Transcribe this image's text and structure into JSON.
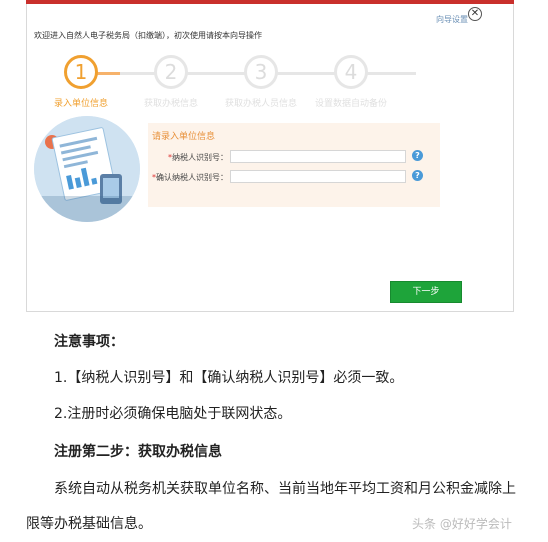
{
  "dialog": {
    "welcome_text": "欢迎进入自然人电子税务局（扣缴端），初次使用请按本向导操作",
    "wizard_settings_link": "向导设置",
    "close_glyph": "✕",
    "steps": [
      {
        "number": "1",
        "label": "录入单位信息",
        "active": true
      },
      {
        "number": "2",
        "label": "获取办税信息",
        "active": false
      },
      {
        "number": "3",
        "label": "获取办税人员信息",
        "active": false
      },
      {
        "number": "4",
        "label": "设置数据自动备份",
        "active": false
      }
    ],
    "form": {
      "title": "请录入单位信息",
      "taxpayer_id_label": "纳税人识别号：",
      "taxpayer_id_value": "",
      "confirm_taxpayer_id_label": "确认纳税人识别号：",
      "confirm_taxpayer_id_value": "",
      "required_mark": "*",
      "help_glyph": "?"
    },
    "next_button_label": "下一步",
    "colors": {
      "accent_orange": "#f0a030",
      "next_green": "#1ea43a",
      "top_bar_red": "#c9302c",
      "help_blue": "#4a9ad8"
    }
  },
  "article": {
    "notes_heading": "注意事项：",
    "note_1": "1.【纳税人识别号】和【确认纳税人识别号】必须一致。",
    "note_2": "2.注册时必须确保电脑处于联网状态。",
    "step2_heading": "注册第二步：获取办税信息",
    "paragraph_line_1": "系统自动从税务机关获取单位名称、当前当地年平均工资和月公积金减除上",
    "paragraph_line_2": "限等办税基础信息。"
  },
  "watermark": "头条 @好好学会计"
}
